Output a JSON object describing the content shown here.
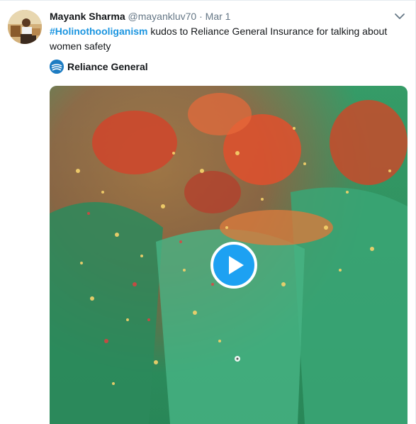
{
  "tweet": {
    "display_name": "Mayank Sharma",
    "handle": "@mayankluv70",
    "separator": "·",
    "time": "Mar 1",
    "hashtag": "#Holinothooliganism",
    "text_rest": " kudos to Reliance General Insurance for talking about women safety",
    "promoter": {
      "name": "Reliance General",
      "logo_icon": "reliance-general-logo-icon"
    },
    "media": {
      "type": "video",
      "play_icon": "play-circle-icon"
    },
    "menu_icon": "chevron-down-icon"
  },
  "colors": {
    "hashtag": "#1b95e0",
    "text": "#14171a",
    "secondary": "#657786",
    "play_button": "#1da1f2"
  }
}
